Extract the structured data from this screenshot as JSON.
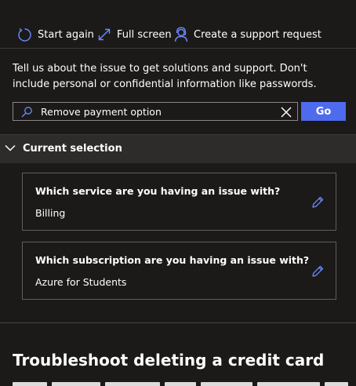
{
  "toolbar": {
    "start_again_label": "Start again",
    "full_screen_label": "Full screen",
    "support_request_label": "Create a support request"
  },
  "intro_text": "Tell us about the issue to get solutions and support. Don't include personal or confidential information like passwords.",
  "search": {
    "value": "Remove payment option",
    "go_label": "Go"
  },
  "current_selection": {
    "title": "Current selection",
    "items": [
      {
        "question": "Which service are you having an issue with?",
        "answer": "Billing"
      },
      {
        "question": "Which subscription are you having an issue with?",
        "answer": "Azure for Students"
      }
    ]
  },
  "article": {
    "heading": "Troubleshoot deleting a credit card"
  },
  "colors": {
    "background": "#1b1a19",
    "section_header": "#2d2c2b",
    "accent": "#4f6bed",
    "icon_blue": "#6b8cff",
    "border": "#605e5c"
  }
}
